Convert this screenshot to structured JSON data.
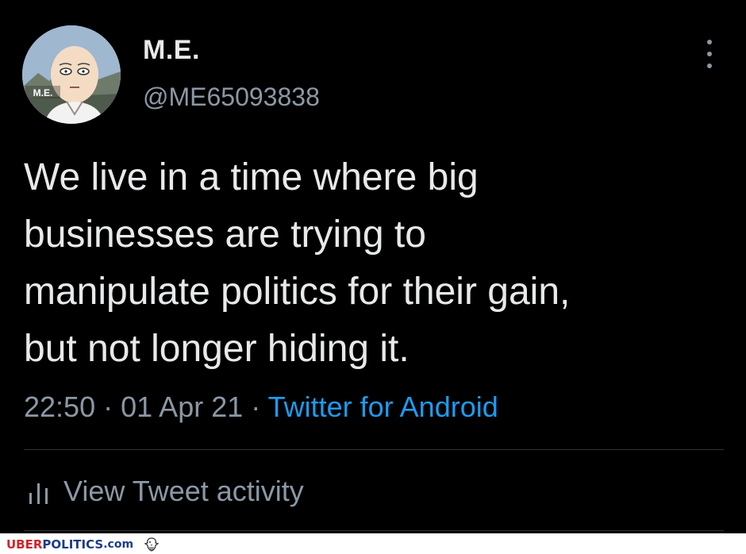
{
  "tweet": {
    "display_name": "M.E.",
    "handle": "@ME65093838",
    "avatar_label": "M.E.",
    "text": "We live in a time where big\nbusinesses are trying to\nmanipulate politics for their gain,\nbut not longer hiding it.",
    "time": "22:50",
    "date": "01 Apr 21",
    "separator": "·",
    "source": "Twitter for Android"
  },
  "actions": {
    "view_activity": "View Tweet activity",
    "activity_icon": "bar-chart-icon",
    "more_icon": "vertical-dots-icon"
  },
  "watermark": {
    "uber": "UBER",
    "politics": "POLITICS",
    "com": ".com",
    "icon": "eagle-icon"
  },
  "colors": {
    "background": "#000000",
    "text": "#e7e9ea",
    "secondary": "#8b98a5",
    "link": "#1d9bf0",
    "divider": "#2f3336",
    "watermark_red": "#d3232b",
    "watermark_blue": "#1c3c86"
  }
}
